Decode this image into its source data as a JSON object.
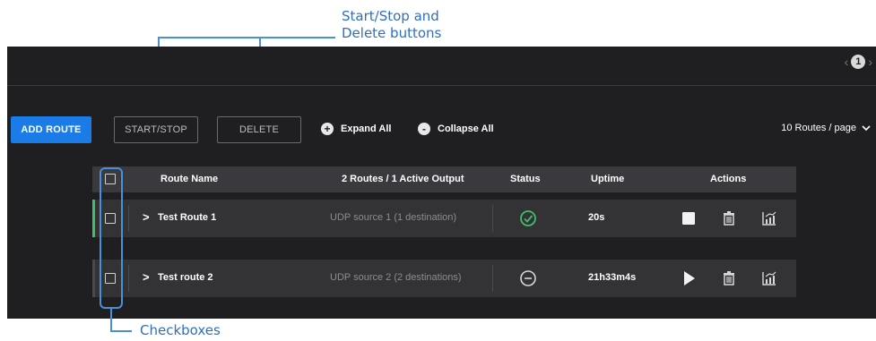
{
  "annotations": {
    "top_callout_line1": "Start/Stop and",
    "top_callout_line2": "Delete buttons",
    "bottom_callout": "Checkboxes"
  },
  "pagination": {
    "current_page": "1",
    "prev_icon": "chevron-left-icon",
    "next_icon": "chevron-right-icon"
  },
  "toolbar": {
    "add_route": "ADD ROUTE",
    "start_stop": "START/STOP",
    "delete": "DELETE",
    "expand_all": "Expand All",
    "collapse_all": "Collapse All",
    "per_page": "10 Routes / page"
  },
  "table": {
    "headers": {
      "route_name": "Route Name",
      "outputs": "2 Routes / 1 Active Output",
      "status": "Status",
      "uptime": "Uptime",
      "actions": "Actions"
    },
    "rows": [
      {
        "name": "Test Route 1",
        "output": "UDP source 1 (1 destination)",
        "status": "running",
        "uptime": "20s",
        "action": "stop",
        "marker_color": "#3fbf6b"
      },
      {
        "name": "Test route 2",
        "output": "UDP source 2 (2 destinations)",
        "status": "stopped",
        "uptime": "21h33m4s",
        "action": "start",
        "marker_color": "#4a4a4e"
      }
    ]
  },
  "colors": {
    "accent": "#1b7ce8",
    "status_ok": "#3fbf6b",
    "annotation": "#2f6fbf"
  }
}
